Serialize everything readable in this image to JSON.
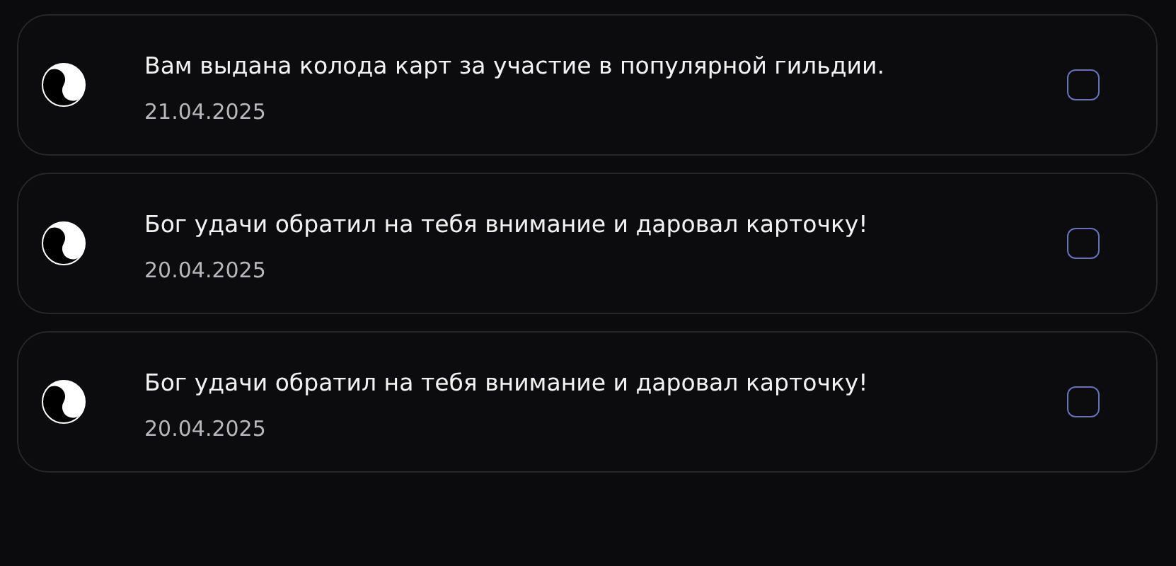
{
  "notifications": [
    {
      "message": "Вам выдана колода карт за участие в популярной гильдии.",
      "date": "21.04.2025",
      "checked": false
    },
    {
      "message": "Бог удачи обратил на тебя внимание и даровал карточку!",
      "date": "20.04.2025",
      "checked": false
    },
    {
      "message": "Бог удачи обратил на тебя внимание и даровал карточку!",
      "date": "20.04.2025",
      "checked": false
    }
  ]
}
